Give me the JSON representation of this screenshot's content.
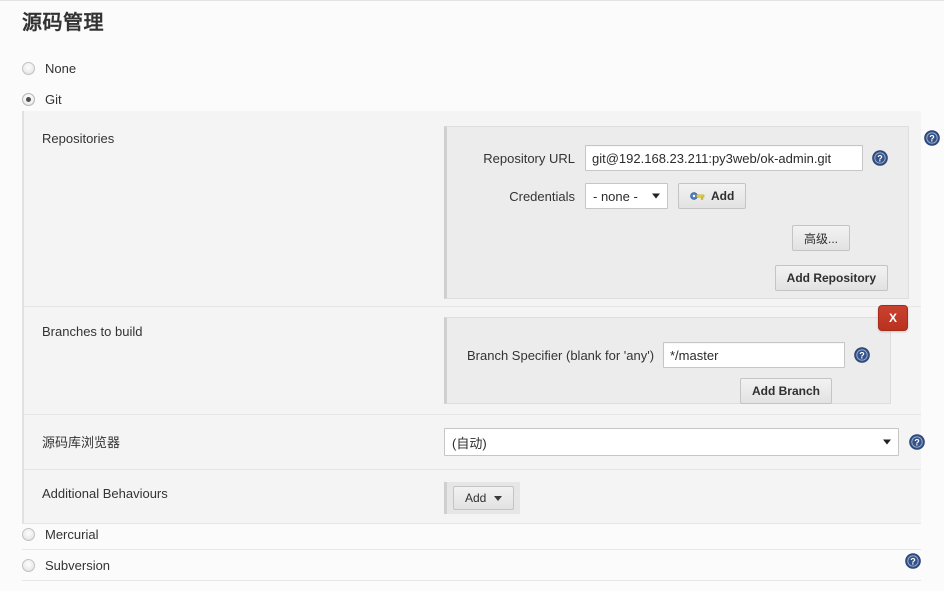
{
  "page": {
    "title": "源码管理"
  },
  "scm_options": [
    {
      "label": "None",
      "selected": false
    },
    {
      "label": "Git",
      "selected": true
    },
    {
      "label": "Mercurial",
      "selected": false
    },
    {
      "label": "Subversion",
      "selected": false
    }
  ],
  "git": {
    "repositories": {
      "label": "Repositories",
      "repository_url": {
        "label": "Repository URL",
        "value": "git@192.168.23.211:py3web/ok-admin.git"
      },
      "credentials": {
        "label": "Credentials",
        "selected": "- none -",
        "add_button": "Add"
      },
      "advanced_button": "高级...",
      "add_repository_button": "Add Repository"
    },
    "branches": {
      "label": "Branches to build",
      "branch_specifier": {
        "label": "Branch Specifier (blank for 'any')",
        "value": "*/master"
      },
      "add_branch_button": "Add Branch",
      "delete_button": "X"
    },
    "repository_browser": {
      "label": "源码库浏览器",
      "selected": "(自动)"
    },
    "additional_behaviours": {
      "label": "Additional Behaviours",
      "add_button": "Add"
    }
  },
  "icons": {
    "help": "help-icon",
    "key": "key-icon",
    "caret_down": "chevron-down-icon"
  },
  "colors": {
    "help_blue": "#34538b",
    "delete_red": "#c0392b",
    "page_background": "#fbfbfb",
    "panel_background": "#ececec",
    "section_background": "#f4f4f4"
  }
}
